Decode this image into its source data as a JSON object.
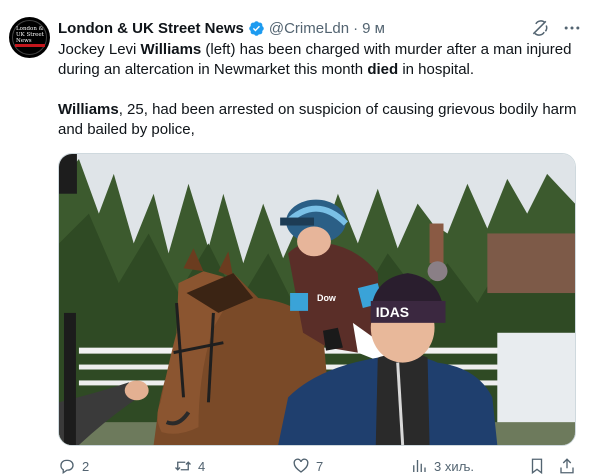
{
  "tweet": {
    "author": {
      "display_name": "London & UK Street News",
      "handle": "@CrimeLdn",
      "avatar_text": "London & UK Street News",
      "verified": true
    },
    "separator": "·",
    "time": "9 м",
    "body": {
      "p1_a": "Jockey Levi ",
      "p1_b": "Williams",
      "p1_c": " (left) has been charged with murder after a man injured during an altercation in Newmarket this month ",
      "p1_d": "died",
      "p1_e": " in hospital.",
      "p2_a": "Williams",
      "p2_b": ", 25, had been arrested on suspicion of causing grievous bodily harm and bailed by police,"
    },
    "media": {
      "silk_text": "Dow",
      "hat_text": "IDAS"
    },
    "actions": {
      "replies": "2",
      "reposts": "4",
      "likes": "7",
      "views": "3 хиљ."
    }
  },
  "colors": {
    "text_primary": "#0f1419",
    "text_secondary": "#536471",
    "verified_blue": "#1d9bf0",
    "border": "#cfd9de"
  },
  "icons": [
    "verified-badge-icon",
    "grok-icon",
    "more-icon",
    "reply-icon",
    "retweet-icon",
    "like-icon",
    "views-icon",
    "bookmark-icon",
    "share-icon"
  ]
}
